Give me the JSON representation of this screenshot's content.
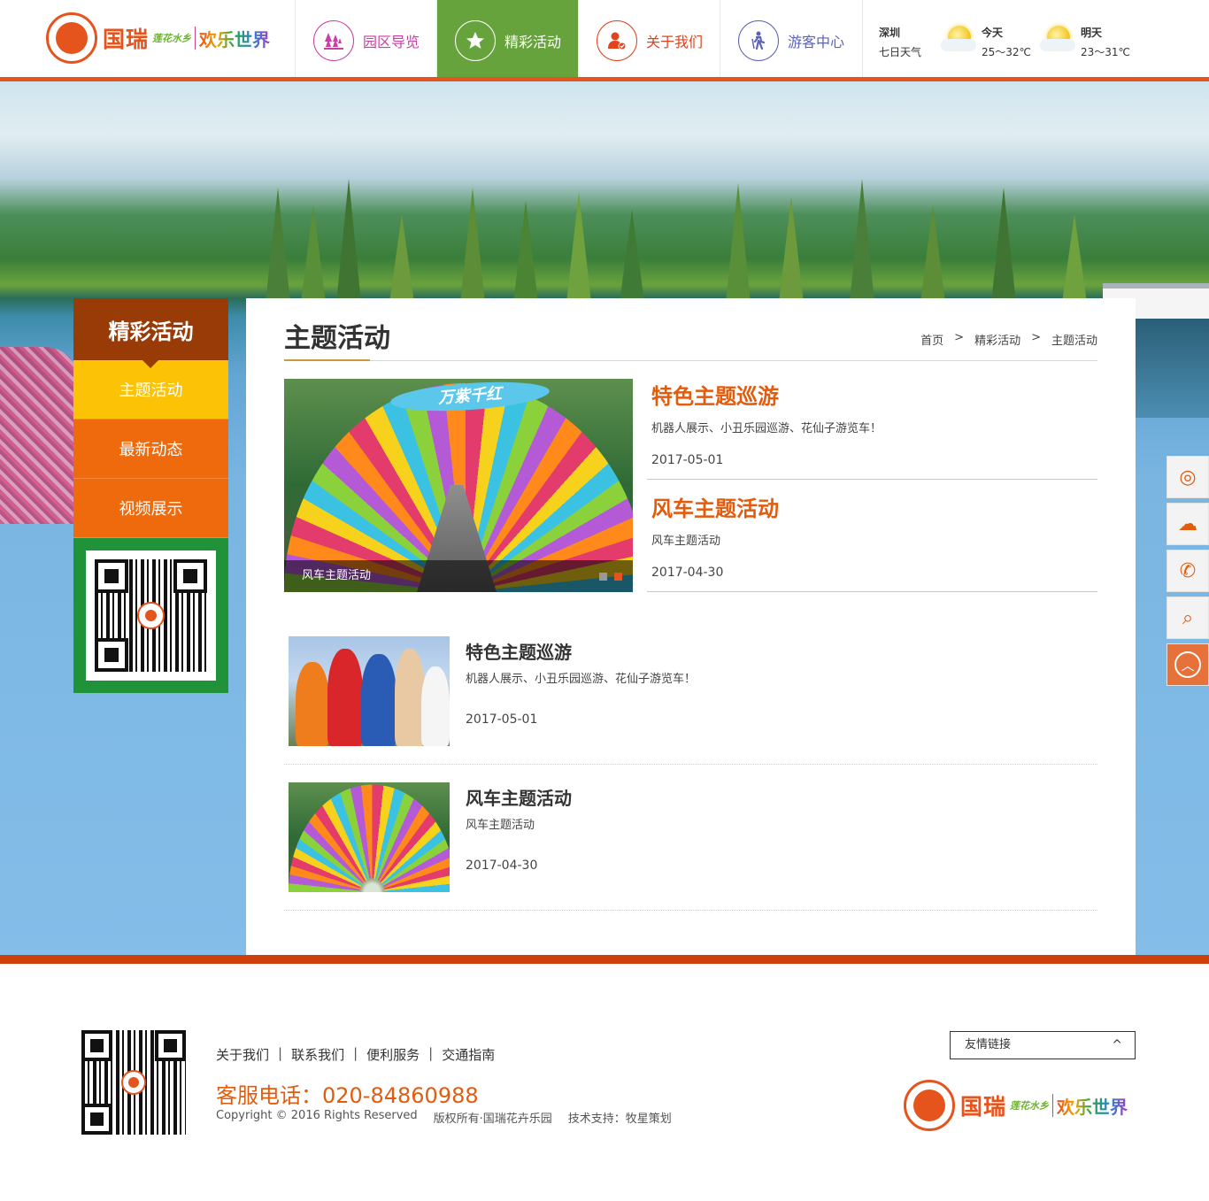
{
  "header": {
    "logo": {
      "main": "国瑞",
      "sub": "莲花水乡",
      "fun": "欢乐世界"
    },
    "nav": [
      {
        "label": "园区导览",
        "icon": "forest-icon",
        "color": "#c93fa3",
        "active": false
      },
      {
        "label": "精彩活动",
        "icon": "star-icon",
        "color": "#67a33c",
        "active": true
      },
      {
        "label": "关于我们",
        "icon": "user-check-icon",
        "color": "#e2421c",
        "active": false
      },
      {
        "label": "游客中心",
        "icon": "walker-icon",
        "color": "#5a63b8",
        "active": false
      }
    ],
    "weather": {
      "city": "深圳",
      "forecast_label": "七日天气",
      "today": {
        "label": "今天",
        "temp": "25～32℃",
        "icon": "sunny-cloud-icon"
      },
      "tomorrow": {
        "label": "明天",
        "temp": "23～31℃",
        "icon": "sunny-cloud-icon"
      }
    }
  },
  "sidebar": {
    "title": "精彩活动",
    "items": [
      {
        "label": "主题活动",
        "active": true
      },
      {
        "label": "最新动态",
        "active": false
      },
      {
        "label": "视频展示",
        "active": false
      }
    ]
  },
  "main": {
    "title": "主题活动",
    "breadcrumb": [
      "首页",
      ">",
      "精彩活动",
      ">",
      "主题活动"
    ],
    "slider": {
      "sign_text": "万紫千红",
      "caption": "风车主题活动",
      "active_dot": 1
    },
    "features": [
      {
        "title": "特色主题巡游",
        "desc": "机器人展示、小丑乐园巡游、花仙子游览车！",
        "date": "2017-05-01"
      },
      {
        "title": "风车主题活动",
        "desc": "风车主题活动",
        "date": "2017-04-30"
      }
    ],
    "list": [
      {
        "title": "特色主题巡游",
        "desc": "机器人展示、小丑乐园巡游、花仙子游览车！",
        "date": "2017-05-01"
      },
      {
        "title": "风车主题活动",
        "desc": "风车主题活动",
        "date": "2017-04-30"
      }
    ]
  },
  "float_bar": [
    {
      "icon": "weibo-icon",
      "glyph": "◎"
    },
    {
      "icon": "wechat-icon",
      "glyph": "☁"
    },
    {
      "icon": "phone-icon",
      "glyph": "✆"
    },
    {
      "icon": "search-icon",
      "glyph": "⌕"
    },
    {
      "icon": "back-to-top-icon",
      "glyph": "︿"
    }
  ],
  "footer": {
    "links": [
      "关于我们",
      "联系我们",
      "便利服务",
      "交通指南"
    ],
    "separator": "|",
    "tel": "客服电话：020-84860988",
    "copyright": "Copyright © 2016 Rights Reserved",
    "rights": "版权所有·国瑞花卉乐园",
    "tech": "技术支持：牧星策划",
    "friend_links_label": "友情链接",
    "friend_links_arrow": "^"
  },
  "colors": {
    "accent": "#e5541c",
    "sidebar_head": "#993b07",
    "sidebar_item": "#ef6a0c",
    "sidebar_active": "#fbc206",
    "qr_frame": "#20923a"
  }
}
